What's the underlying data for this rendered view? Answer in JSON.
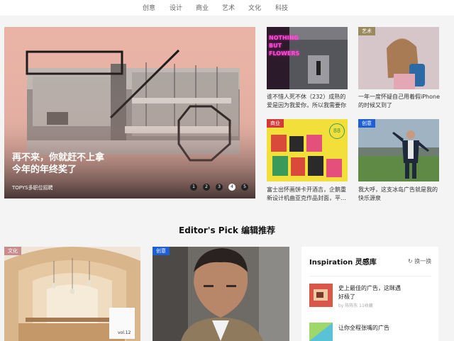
{
  "nav": {
    "items": [
      "创意",
      "设计",
      "商业",
      "艺术",
      "文化",
      "科技"
    ]
  },
  "hero": {
    "title_line1": "再不来，你就赶不上拿",
    "title_line2": "今年的年终奖了",
    "source": "TOPYS多职位招聘",
    "pages": [
      "1",
      "2",
      "3",
      "4",
      "5"
    ],
    "active_page": 4
  },
  "side_cards": [
    {
      "neon_text": "NOTHING BUT FLOWERS",
      "caption_line1": "谁不惜人死不休（232）成熟的",
      "caption_line2": "爱是因为我爱你，所以我需要你"
    },
    {
      "tag": "艺术",
      "caption_line1": "一年一度怀疑自己用着假iPhone",
      "caption_line2": "的时候又到了"
    },
    {
      "tag": "商业",
      "badge": "88",
      "caption_line1": "富士出怀画饼卡开酒吉，企鹅重",
      "caption_line2": "新设计机曲亚克作品封面，平…"
    },
    {
      "tag": "创意",
      "caption_line1": "我大呼，这支冰岛广告就是我的",
      "caption_line2": "快乐源泉"
    }
  ],
  "editors_pick": {
    "title": "Editor's Pick 编辑推荐"
  },
  "pick_cards": [
    {
      "tag": "文化",
      "shop_sign": "vol.12"
    },
    {
      "tag": "创意"
    }
  ],
  "inspiration": {
    "title": "Inspiration 灵感库",
    "refresh": "换一换",
    "items": [
      {
        "title_line1": "史上最佳的广告，这眯遇",
        "title_line2": "好极了",
        "meta": "by 陈陈东 11收藏"
      },
      {
        "title_line1": "让你全程张嘴的广告"
      }
    ]
  },
  "colors": {
    "tag_red": "#d23a3a",
    "tag_blue": "#1f5fd6",
    "tag_olive": "#9a8a5e",
    "tag_pink": "#c98c8c",
    "hero_tint": "#e9b3a6"
  }
}
